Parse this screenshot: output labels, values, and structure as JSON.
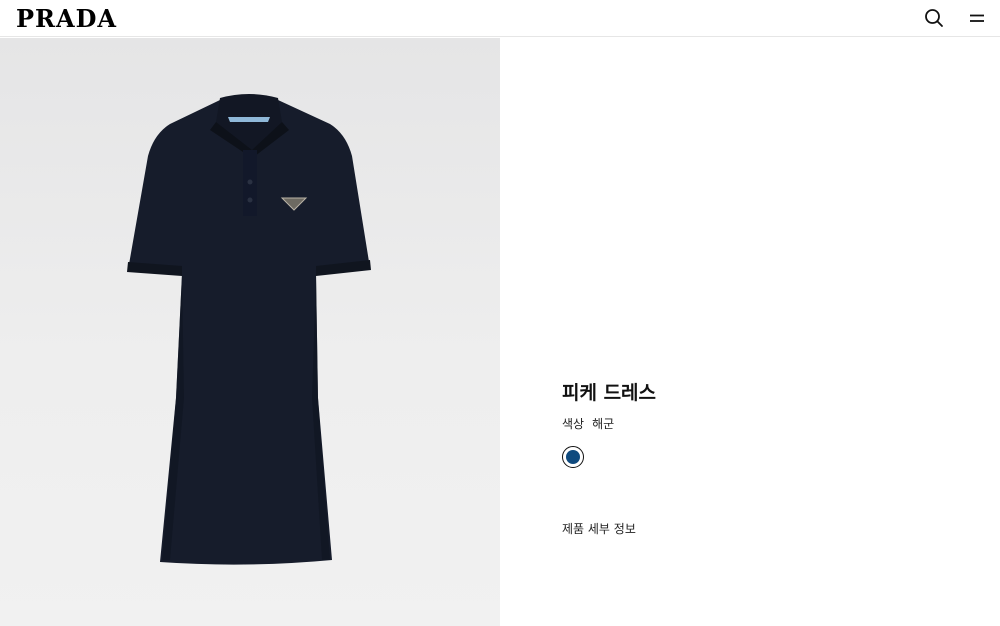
{
  "header": {
    "logo": "PRADA",
    "search_icon": "search-icon",
    "menu_icon": "menu-icon"
  },
  "product": {
    "image_alt": "navy-pique-polo-dress",
    "name": "피케 드레스",
    "color_label": "색상",
    "color_value": "해군",
    "swatch_color": "#0f4a7e",
    "details_label": "제품 세부 정보"
  },
  "colors": {
    "dress": "#161c2b",
    "collar_tip": "#8fb8d8",
    "background": "#ebebeb"
  }
}
